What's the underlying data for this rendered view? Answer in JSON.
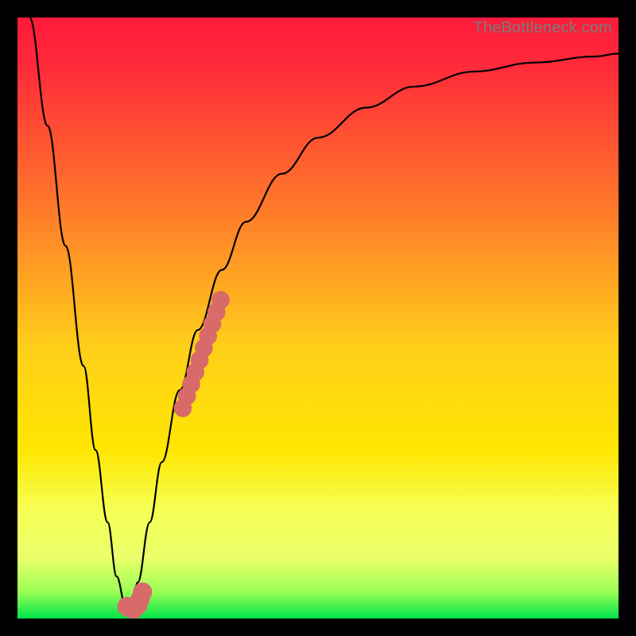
{
  "watermark": "TheBottleneck.com",
  "colors": {
    "frame": "#000000",
    "grad_top": "#ff1a3a",
    "grad_mid1": "#ff8a2a",
    "grad_mid2": "#ffe600",
    "grad_band": "#f3ff66",
    "grad_bottom": "#00e34a",
    "curve": "#000000",
    "marker": "#d86a6a"
  },
  "chart_data": {
    "type": "line",
    "title": "",
    "xlabel": "",
    "ylabel": "",
    "xlim": [
      0,
      100
    ],
    "ylim": [
      0,
      100
    ],
    "series": [
      {
        "name": "bottleneck-curve",
        "x": [
          2,
          5,
          8,
          11,
          13,
          15,
          16.5,
          18,
          19,
          20,
          22,
          24,
          27,
          30,
          34,
          38,
          44,
          50,
          58,
          66,
          76,
          86,
          96,
          100
        ],
        "y": [
          100,
          82,
          62,
          42,
          28,
          16,
          7,
          2,
          2,
          6,
          16,
          26,
          38,
          48,
          58,
          66,
          74,
          80,
          85,
          88.5,
          91,
          92.5,
          93.5,
          94
        ]
      }
    ],
    "markers": [
      {
        "name": "hook-marker",
        "points": [
          [
            18.2,
            2.0
          ],
          [
            18.8,
            1.7
          ],
          [
            19.4,
            1.6
          ],
          [
            20.0,
            2.2
          ],
          [
            20.4,
            3.2
          ],
          [
            20.8,
            4.4
          ]
        ],
        "radius": 1.6
      },
      {
        "name": "ascending-marker",
        "points": [
          [
            27.5,
            35.0
          ],
          [
            28.2,
            37.0
          ],
          [
            28.9,
            39.0
          ],
          [
            29.6,
            41.0
          ],
          [
            30.3,
            43.0
          ],
          [
            31.0,
            45.0
          ],
          [
            31.7,
            47.0
          ],
          [
            32.4,
            49.0
          ],
          [
            33.1,
            51.0
          ],
          [
            33.8,
            53.0
          ]
        ],
        "radius": 1.5
      }
    ],
    "gradient_stops": [
      {
        "offset": 0.0,
        "color": "#ff1a3a"
      },
      {
        "offset": 0.08,
        "color": "#ff2a3a"
      },
      {
        "offset": 0.32,
        "color": "#ff7a2a"
      },
      {
        "offset": 0.55,
        "color": "#ffcf1a"
      },
      {
        "offset": 0.72,
        "color": "#ffe600"
      },
      {
        "offset": 0.82,
        "color": "#f6ff55"
      },
      {
        "offset": 0.9,
        "color": "#e9ff6a"
      },
      {
        "offset": 0.955,
        "color": "#9dff55"
      },
      {
        "offset": 1.0,
        "color": "#00e34a"
      }
    ]
  }
}
